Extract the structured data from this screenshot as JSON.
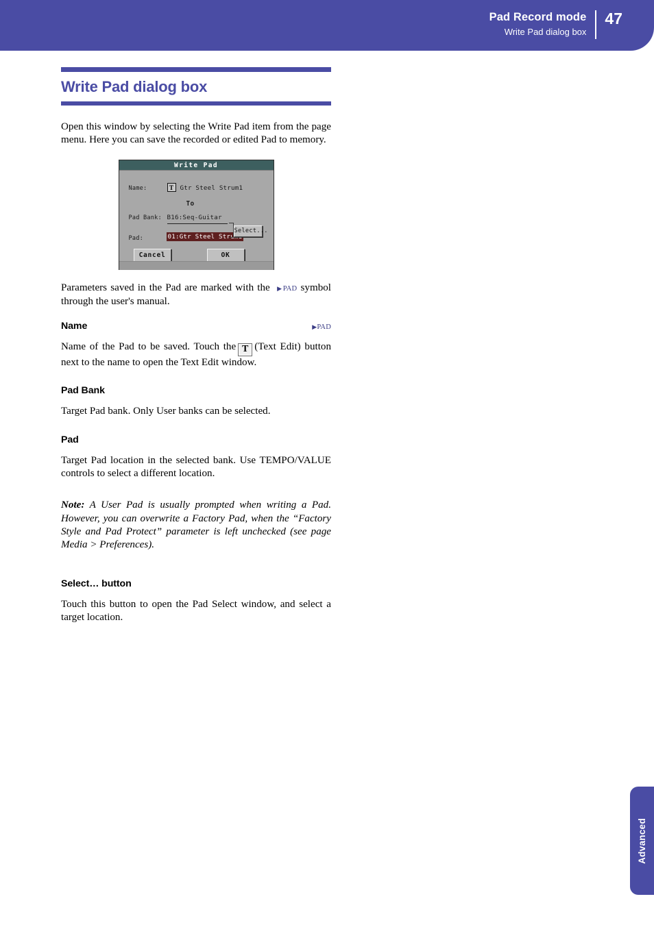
{
  "header": {
    "title": "Pad Record mode",
    "subtitle": "Write Pad dialog box",
    "page_number": "47",
    "accent_color": "#4a4ca4"
  },
  "section": {
    "title": "Write Pad dialog box",
    "intro": "Open this window by selecting the Write Pad item from the page menu. Here you can save the recorded or edited Pad to memory."
  },
  "figure": {
    "dialog_title": "Write Pad",
    "name_label": "Name:",
    "name_value": "Gtr Steel Strum1",
    "text_edit_glyph": "T",
    "to_label": "To",
    "pad_bank_label": "Pad Bank:",
    "pad_bank_value": "B16:Seq-Guitar",
    "pad_label": "Pad:",
    "pad_value": "01:Gtr Steel Strum1",
    "select_button": "Select...",
    "cancel_button": "Cancel",
    "ok_button": "OK",
    "titlebar_color": "#3d5f5f",
    "highlight_color": "#5e1f1f",
    "screen_color": "#a8a8a8"
  },
  "body": {
    "pad_symbol_note_a": "Parameters saved in the Pad are marked with the",
    "pad_symbol_note_b": "symbol through the user's manual.",
    "pad_tag": "PAD"
  },
  "sections": {
    "name": {
      "heading": "Name",
      "tag": "PAD",
      "text_a": "Name of the Pad to be saved. Touch the",
      "text_b": "(Text Edit) button next to the name to open the Text Edit window.",
      "glyph": "T"
    },
    "pad_bank": {
      "heading": "Pad Bank",
      "text": "Target Pad bank. Only User banks can be selected."
    },
    "pad": {
      "heading": "Pad",
      "text": "Target Pad location in the selected bank. Use TEMPO/VALUE controls to select a different location.",
      "note_lead": "Note:",
      "note_text": " A User Pad is usually prompted when writing a Pad. However, you can overwrite a Factory Pad, when the “Factory Style and Pad Protect” parameter is left unchecked (see page Media > Preferences)."
    },
    "select_button": {
      "heading": "Select… button",
      "text": "Touch this button to open the Pad Select window, and select a target location."
    }
  },
  "side_tab": {
    "label": "Advanced"
  }
}
